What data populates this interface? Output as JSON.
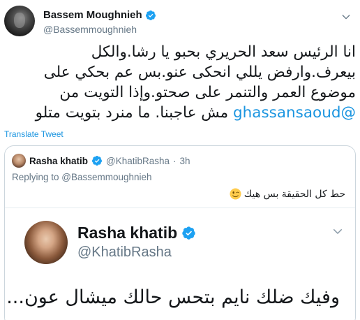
{
  "tweet": {
    "author_name": "Bassem Moughnieh",
    "author_handle": "@Bassemmoughnieh",
    "text_before_mention": "انا الرئيس سعد الحريري بحبو يا رشا.والكل بيعرف.وارفض يللي انحكى عنو.بس عم بحكي على موضوع العمر والتنمر على صحتو.وإذا التويت من ",
    "mention": "@ghassansaoud",
    "text_after_mention": " مش عاجبنا. ما منرد بتويت متلو",
    "translate_label": "Translate Tweet",
    "colors": {
      "link": "#1b95e0",
      "verified": "#1da1f2",
      "muted": "#657786"
    }
  },
  "quoted": {
    "author_name": "Rasha khatib",
    "author_handle": "@KhatibRasha",
    "separator": "·",
    "time": "3h",
    "replying_to": "Replying to @Bassemmoughnieh",
    "text": "حط كل الحقيقة بس هيك",
    "emoji": "winking-face",
    "image": {
      "author_name": "Rasha khatib",
      "author_handle": "@KhatibRasha",
      "text": "وفيك ضلك نايم بتحس حالك ميشال عون..."
    }
  }
}
